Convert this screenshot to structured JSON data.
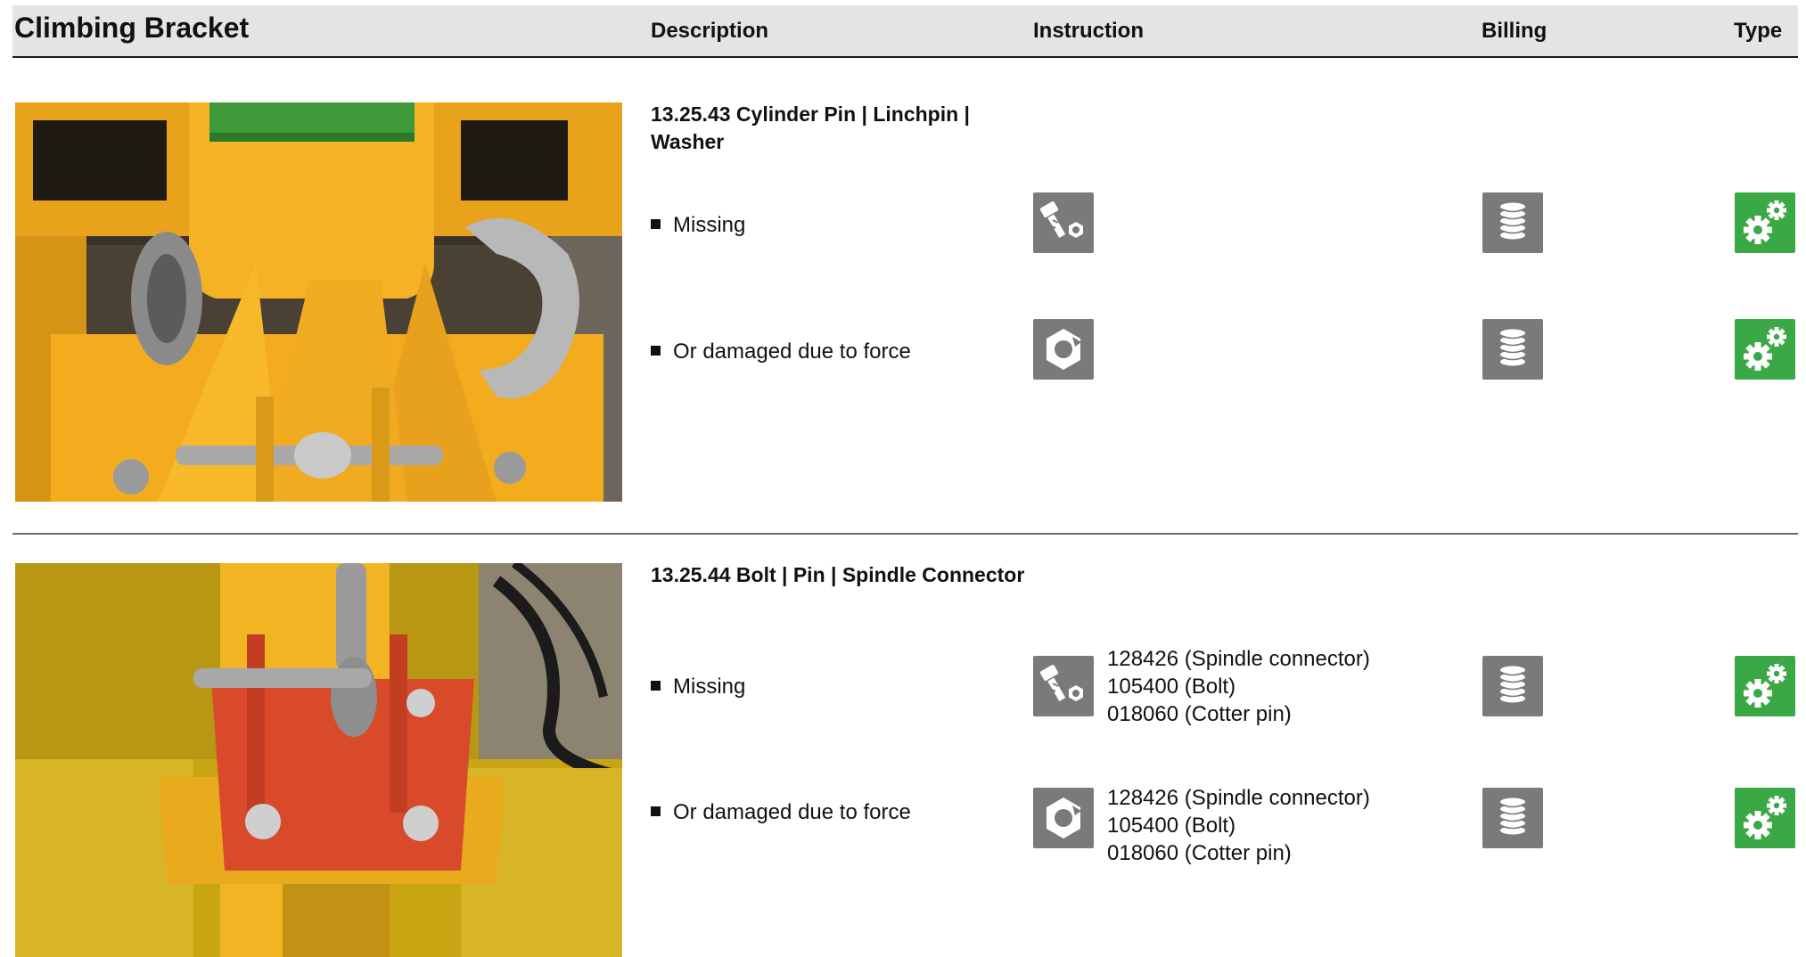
{
  "header": {
    "title": "Climbing Bracket",
    "columns": {
      "description": "Description",
      "instruction": "Instruction",
      "billing": "Billing",
      "type": "Type"
    }
  },
  "colors": {
    "header_bg": "#e4e4e4",
    "icon_gray": "#7a7a7a",
    "icon_green": "#3aa845"
  },
  "sections": [
    {
      "title": "13.25.43 Cylinder Pin | Linchpin | Washer",
      "rows": [
        {
          "label": "Missing",
          "instruction_icon": "bolt-nut-icon",
          "billing_icon": "coin-stack-icon",
          "type_icon": "gears-icon",
          "parts": []
        },
        {
          "label": "Or damaged due to force",
          "instruction_icon": "damaged-nut-icon",
          "billing_icon": "coin-stack-icon",
          "type_icon": "gears-icon",
          "parts": []
        }
      ]
    },
    {
      "title": "13.25.44 Bolt | Pin | Spindle Connector",
      "rows": [
        {
          "label": "Missing",
          "instruction_icon": "bolt-nut-icon",
          "billing_icon": "coin-stack-icon",
          "type_icon": "gears-icon",
          "parts": [
            "128426 (Spindle connector)",
            "105400 (Bolt)",
            "018060 (Cotter pin)"
          ]
        },
        {
          "label": "Or damaged due to force",
          "instruction_icon": "damaged-nut-icon",
          "billing_icon": "coin-stack-icon",
          "type_icon": "gears-icon",
          "parts": [
            "128426 (Spindle connector)",
            "105400 (Bolt)",
            "018060 (Cotter pin)"
          ]
        }
      ]
    }
  ]
}
